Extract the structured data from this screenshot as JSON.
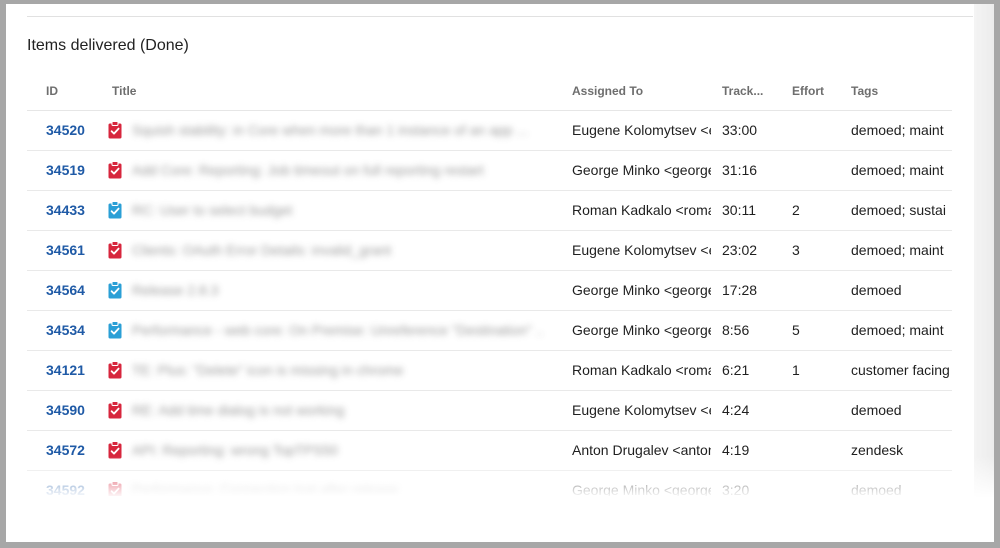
{
  "section": {
    "title": "Items delivered (Done)"
  },
  "columns": {
    "id": "ID",
    "title": "Title",
    "assigned": "Assigned To",
    "track": "Track...",
    "effort": "Effort",
    "tags": "Tags"
  },
  "colors": {
    "bug": "#d7263d",
    "task": "#2a9fd6",
    "id_link": "#1f5aa6"
  },
  "rows": [
    {
      "id": "34520",
      "icon": "bug-icon",
      "title": "Squish stability: in Core when more than 1 instance of an app ...",
      "assigned": "Eugene Kolomytsev <e",
      "track": "33:00",
      "effort": "",
      "tags": "demoed; maint"
    },
    {
      "id": "34519",
      "icon": "bug-icon",
      "title": "Add Core: Reporting: Job timeout on full reporting restart",
      "assigned": "George Minko <george",
      "track": "31:16",
      "effort": "",
      "tags": "demoed; maint"
    },
    {
      "id": "34433",
      "icon": "task-icon",
      "title": "RC: User to select budget",
      "assigned": "Roman Kadkalo <roma",
      "track": "30:11",
      "effort": "2",
      "tags": "demoed; sustai"
    },
    {
      "id": "34561",
      "icon": "bug-icon",
      "title": "Clients: OAuth Error Details: invalid_grant",
      "assigned": "Eugene Kolomytsev <e",
      "track": "23:02",
      "effort": "3",
      "tags": "demoed; maint"
    },
    {
      "id": "34564",
      "icon": "task-icon",
      "title": "Release 2.8.3",
      "assigned": "George Minko <george",
      "track": "17:28",
      "effort": "",
      "tags": "demoed"
    },
    {
      "id": "34534",
      "icon": "task-icon",
      "title": "Performance - web core: On Premise: Unreference \"Destination\" ...",
      "assigned": "George Minko <george",
      "track": "8:56",
      "effort": "5",
      "tags": "demoed; maint"
    },
    {
      "id": "34121",
      "icon": "bug-icon",
      "title": "TE: Plus: \"Delete\" icon is missing in chrome",
      "assigned": "Roman Kadkalo <roma",
      "track": "6:21",
      "effort": "1",
      "tags": "customer facing"
    },
    {
      "id": "34590",
      "icon": "bug-icon",
      "title": "RE: Add time dialog is not working",
      "assigned": "Eugene Kolomytsev <e",
      "track": "4:24",
      "effort": "",
      "tags": "demoed"
    },
    {
      "id": "34572",
      "icon": "bug-icon",
      "title": "API: Reporting: wrong TopTPS50",
      "assigned": "Anton Drugalev <anton",
      "track": "4:19",
      "effort": "",
      "tags": "zendesk"
    },
    {
      "id": "34592",
      "icon": "bug-icon",
      "title": "Performance: Connection lost after release",
      "assigned": "George Minko <george",
      "track": "3:20",
      "effort": "",
      "tags": "demoed"
    }
  ]
}
